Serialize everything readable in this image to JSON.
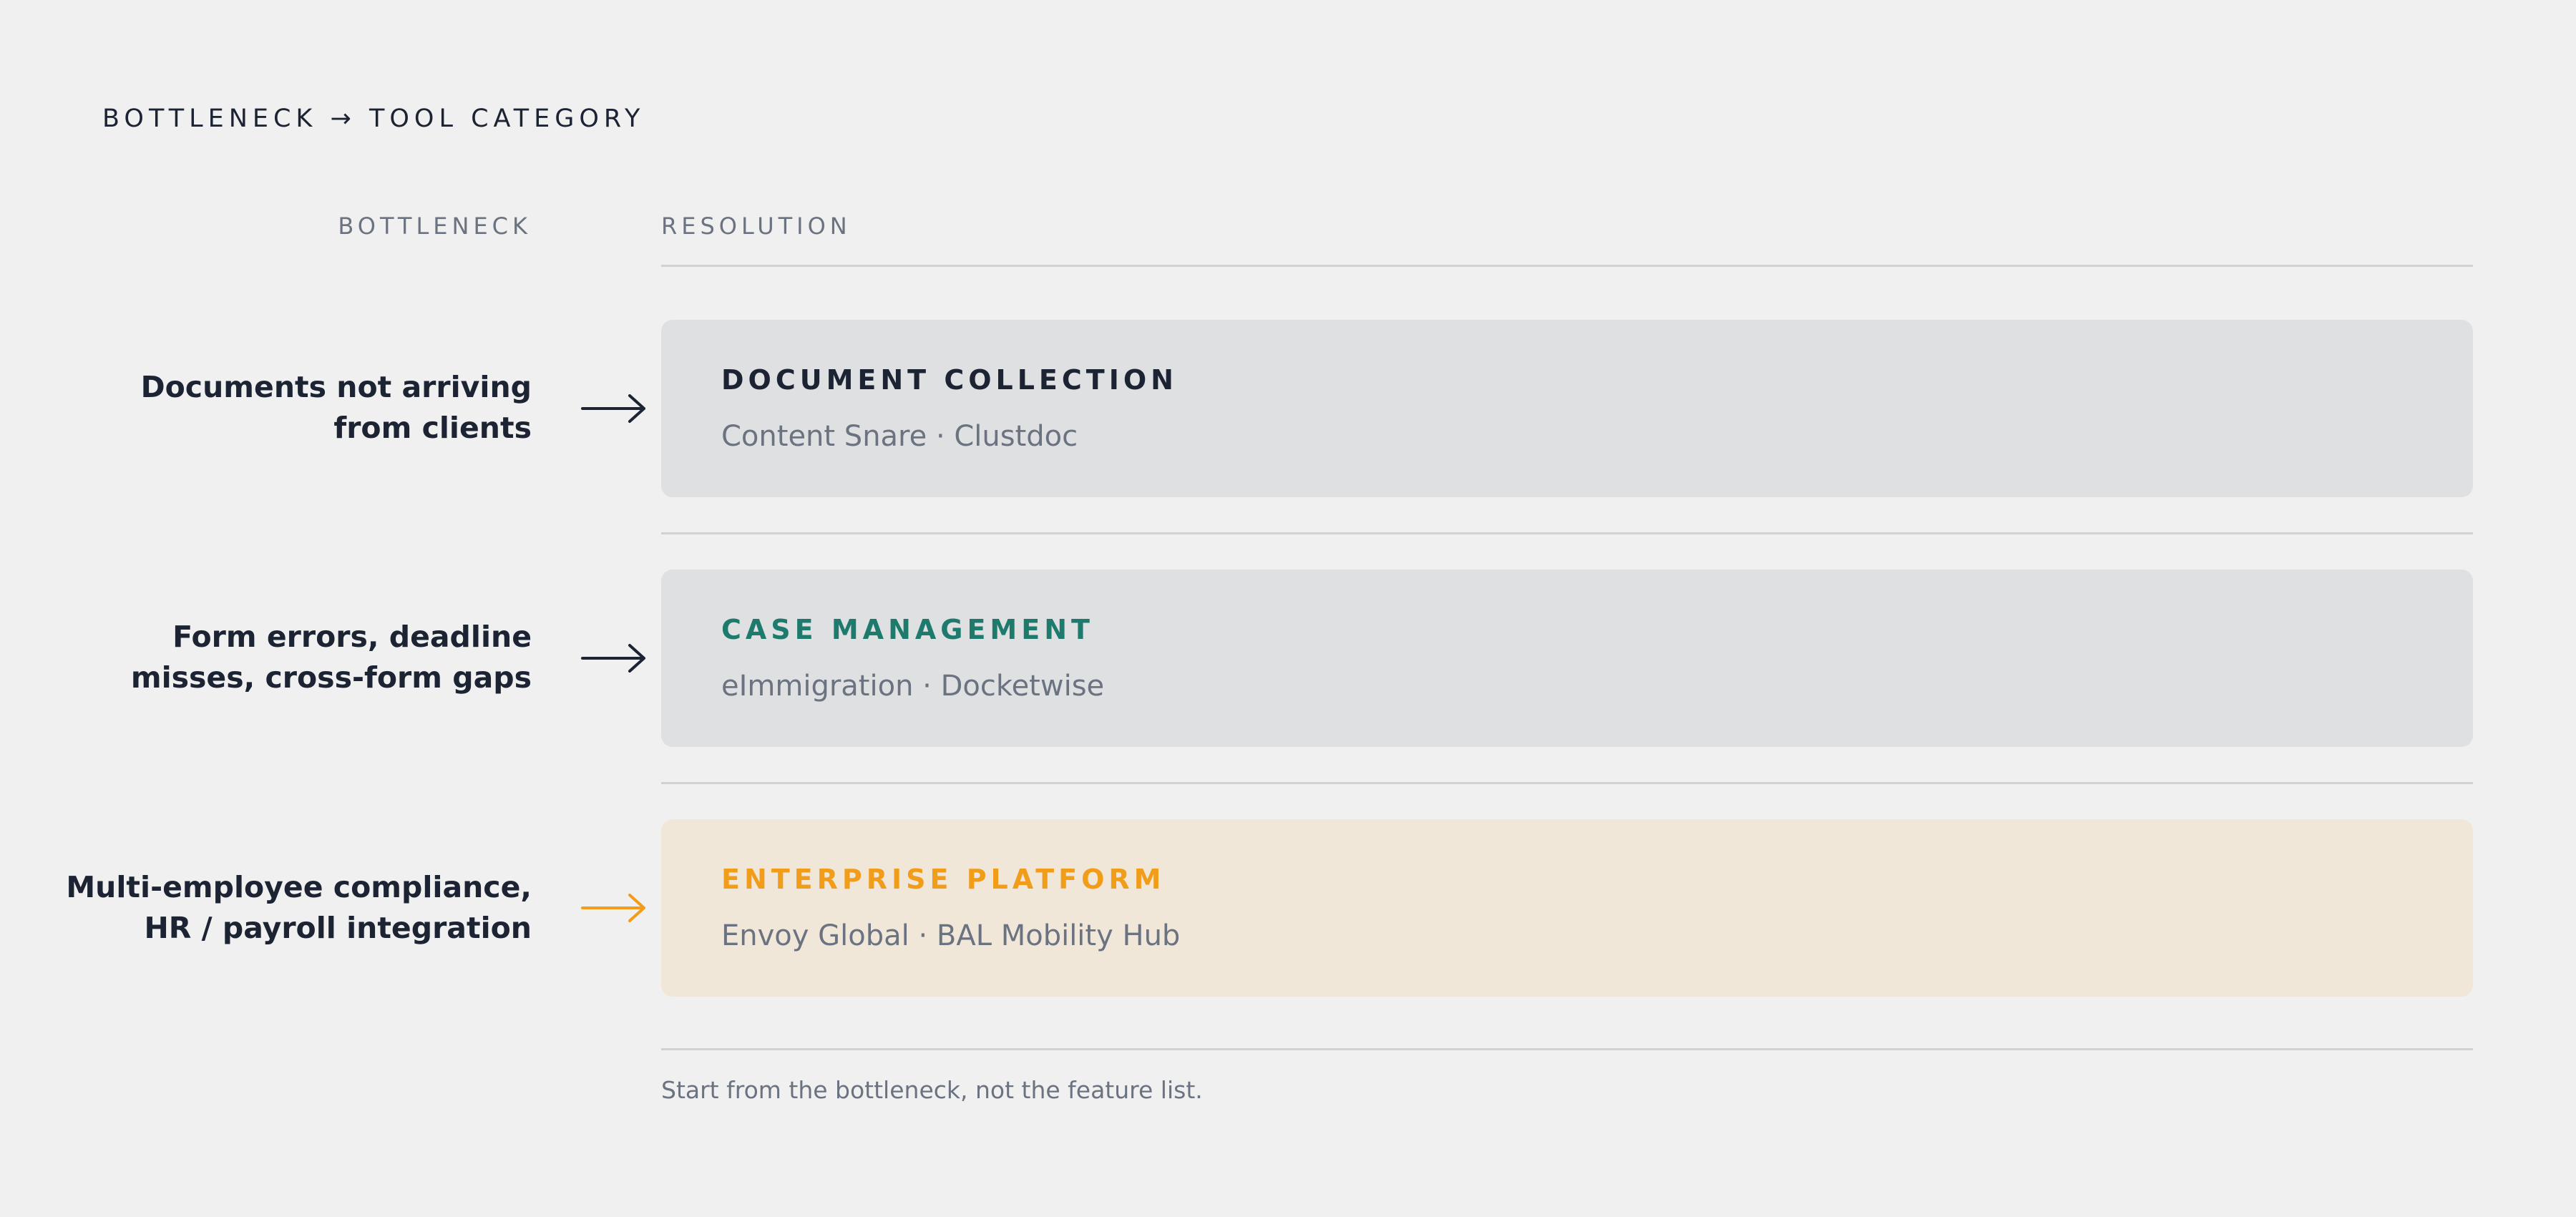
{
  "title": "BOTTLENECK → TOOL CATEGORY",
  "columns": {
    "left": "BOTTLENECK",
    "right": "RESOLUTION"
  },
  "rows": [
    {
      "bottleneck": [
        "Documents not arriving",
        "from clients"
      ],
      "category": "DOCUMENT COLLECTION",
      "tools": "Content Snare · Clustdoc",
      "accent_color": "#1c2333",
      "arrow_color": "#1c2333",
      "card_color": "#dfe0e2"
    },
    {
      "bottleneck": [
        "Form errors, deadline",
        "misses, cross-form gaps"
      ],
      "category": "CASE MANAGEMENT",
      "tools": "eImmigration · Docketwise",
      "accent_color": "#1d7a6c",
      "arrow_color": "#1c2333",
      "card_color": "#dfe0e2"
    },
    {
      "bottleneck": [
        "Multi-employee compliance,",
        "HR / payroll integration"
      ],
      "category": "ENTERPRISE PLATFORM",
      "tools": "Envoy Global · BAL Mobility Hub",
      "accent_color": "#f29d1a",
      "arrow_color": "#f29d1a",
      "card_color": "#f0e7d9"
    }
  ],
  "footnote": "Start from the bottleneck, not the feature list."
}
